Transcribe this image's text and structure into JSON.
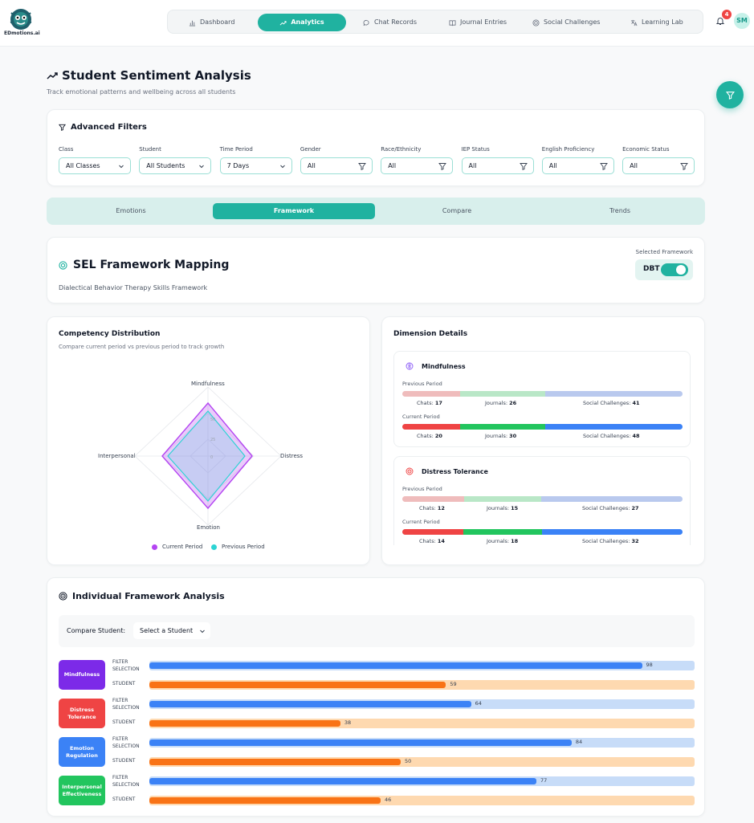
{
  "app": {
    "logo_text": "EDmotions.ai",
    "notifications_count": "4",
    "avatar_initials": "SM"
  },
  "nav": [
    {
      "label": "Dashboard",
      "icon": "bar-chart-icon"
    },
    {
      "label": "Analytics",
      "icon": "trend-icon",
      "active": true
    },
    {
      "label": "Chat Records",
      "icon": "chat-icon"
    },
    {
      "label": "Journal Entries",
      "icon": "book-icon"
    },
    {
      "label": "Social Challenges",
      "icon": "target-icon"
    },
    {
      "label": "Learning Lab",
      "icon": "translate-icon"
    }
  ],
  "page": {
    "title": "Student Sentiment Analysis",
    "subtitle": "Track emotional patterns and wellbeing across all students"
  },
  "filters": {
    "title": "Advanced Filters",
    "items": [
      {
        "label": "Class",
        "value": "All Classes",
        "kind": "select"
      },
      {
        "label": "Student",
        "value": "All Students",
        "kind": "select"
      },
      {
        "label": "Time Period",
        "value": "7 Days",
        "kind": "select"
      },
      {
        "label": "Gender",
        "value": "All",
        "kind": "filter"
      },
      {
        "label": "Race/Ethnicity",
        "value": "All",
        "kind": "filter"
      },
      {
        "label": "IEP Status",
        "value": "All",
        "kind": "filter"
      },
      {
        "label": "English Proficiency",
        "value": "All",
        "kind": "filter"
      },
      {
        "label": "Economic Status",
        "value": "All",
        "kind": "filter"
      }
    ]
  },
  "tabs": [
    {
      "label": "Emotions"
    },
    {
      "label": "Framework",
      "active": true
    },
    {
      "label": "Compare"
    },
    {
      "label": "Trends"
    }
  ],
  "framework": {
    "title": "SEL Framework Mapping",
    "subtitle": "Dialectical Behavior Therapy Skills Framework",
    "selected_label": "Selected Framework",
    "selected_value": "DBT",
    "toggle_on": true
  },
  "competency": {
    "title": "Competency Distribution",
    "subtitle": "Compare current period vs previous period to track growth",
    "axes": [
      "Mindfulness",
      "Distress",
      "Emotion",
      "Interpersonal"
    ],
    "ticks": [
      "50",
      "25",
      "0"
    ],
    "legend": [
      {
        "name": "Current Period",
        "color": "#b445f2"
      },
      {
        "name": "Previous Period",
        "color": "#2dd4d4"
      }
    ]
  },
  "dimension": {
    "title": "Dimension Details",
    "previous_label": "Previous Period",
    "current_label": "Current Period",
    "chats_label": "Chats:",
    "journals_label": "Journals:",
    "social_label": "Social Challenges:",
    "items": [
      {
        "name": "Mindfulness",
        "icon": "brain-icon",
        "icon_color": "#8b5cf6",
        "previous": {
          "chats": "17",
          "journals": "26",
          "social": "41"
        },
        "current": {
          "chats": "20",
          "journals": "30",
          "social": "48"
        }
      },
      {
        "name": "Distress Tolerance",
        "icon": "target-icon",
        "icon_color": "#ef4444",
        "previous": {
          "chats": "12",
          "journals": "15",
          "social": "27"
        },
        "current": {
          "chats": "14",
          "journals": "18",
          "social": "32"
        }
      }
    ]
  },
  "individual": {
    "title": "Individual Framework Analysis",
    "compare_label": "Compare Student:",
    "compare_placeholder": "Select a Student",
    "filter_label": "FILTER SELECTION",
    "student_label": "STUDENT",
    "rows": [
      {
        "name": "Mindfulness",
        "color": "#7c2ae8",
        "filter": 98,
        "student": 59
      },
      {
        "name": "Distress Tolerance",
        "color": "#ef4444",
        "filter": 64,
        "student": 38
      },
      {
        "name": "Emotion Regulation",
        "color": "#3b82f6",
        "filter": 84,
        "student": 50
      },
      {
        "name": "Interpersonal Effectiveness",
        "color": "#22c55e",
        "filter": 77,
        "student": 46
      }
    ]
  },
  "colors": {
    "accent": "#20b2a0",
    "chats_bar": "#ef4444",
    "journals_bar": "#22c55e",
    "social_bar": "#3b82f6",
    "filter_bar": "#3b82f6",
    "student_bar": "#f97316"
  }
}
